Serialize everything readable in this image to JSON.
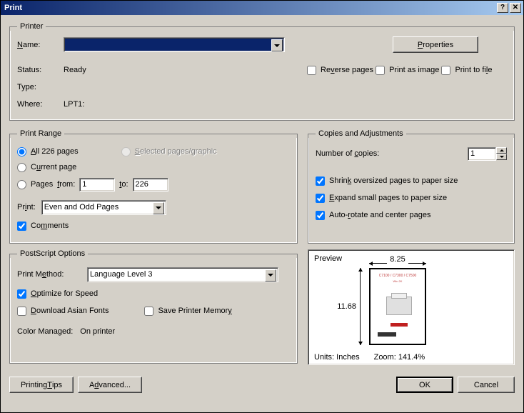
{
  "window": {
    "title": "Print"
  },
  "printer": {
    "legend": "Printer",
    "name_label": "Name:",
    "name_value": "",
    "properties_btn": "Properties",
    "status_label": "Status:",
    "status_value": "Ready",
    "type_label": "Type:",
    "type_value": "",
    "where_label": "Where:",
    "where_value": "LPT1:",
    "reverse_label": "Reverse pages",
    "printimage_label": "Print as image",
    "printfile_label": "Print to file"
  },
  "range": {
    "legend": "Print Range",
    "all_label": "All 226 pages",
    "selected_label": "Selected pages/graphic",
    "current_label": "Current page",
    "pages_label": "Pages",
    "from_label": "from:",
    "from_value": "1",
    "to_label": "to:",
    "to_value": "226",
    "print_label": "Print:",
    "print_value": "Even and Odd Pages",
    "comments_label": "Comments"
  },
  "copies": {
    "legend": "Copies and Adjustments",
    "num_label": "Number of copies:",
    "num_value": "1",
    "shrink_label": "Shrink oversized pages to paper size",
    "expand_label": "Expand small pages to paper size",
    "rotate_label": "Auto-rotate and center pages"
  },
  "ps": {
    "legend": "PostScript Options",
    "method_label": "Print Method:",
    "method_value": "Language Level 3",
    "optimize_label": "Optimize for Speed",
    "asian_label": "Download Asian Fonts",
    "mem_label": "Save Printer Memory",
    "color_label": "Color Managed:",
    "color_value": "On printer"
  },
  "preview": {
    "label": "Preview",
    "width": "8.25",
    "height": "11.68",
    "units_label": "Units: Inches",
    "zoom_label": "Zoom: 141.4%"
  },
  "footer": {
    "tips": "Printing Tips",
    "advanced": "Advanced...",
    "ok": "OK",
    "cancel": "Cancel"
  }
}
